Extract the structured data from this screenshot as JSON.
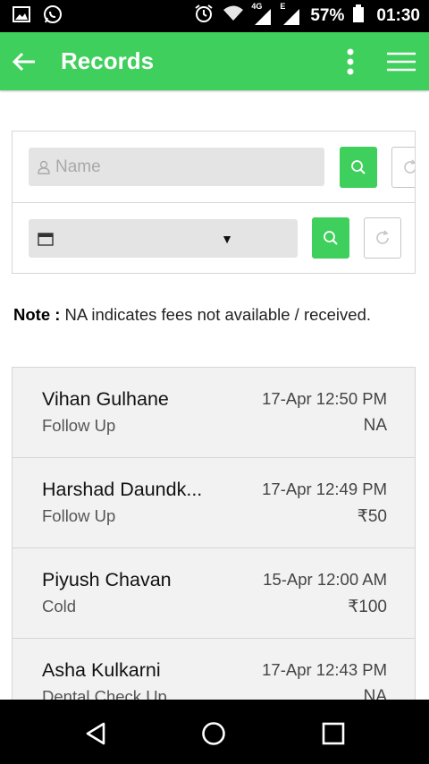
{
  "status_bar": {
    "battery_percent": "57%",
    "time": "01:30",
    "network_4g": "4G",
    "network_e": "E"
  },
  "appbar": {
    "title": "Records"
  },
  "search": {
    "name_placeholder": "Name",
    "date_value": ""
  },
  "note": {
    "label": "Note :",
    "text": " NA indicates fees not available / received."
  },
  "records": [
    {
      "name": "Vihan Gulhane",
      "type": "Follow Up",
      "date": "17-Apr 12:50 PM",
      "fee": "NA"
    },
    {
      "name": "Harshad Daundk...",
      "type": "Follow Up",
      "date": "17-Apr 12:49 PM",
      "fee": "₹50"
    },
    {
      "name": "Piyush Chavan",
      "type": "Cold",
      "date": "15-Apr 12:00 AM",
      "fee": "₹100"
    },
    {
      "name": "Asha Kulkarni",
      "type": "Dental Check Up",
      "date": "17-Apr 12:43 PM",
      "fee": "NA"
    }
  ],
  "colors": {
    "accent": "#3fcf5c",
    "row_bg": "#f2f2f2"
  }
}
